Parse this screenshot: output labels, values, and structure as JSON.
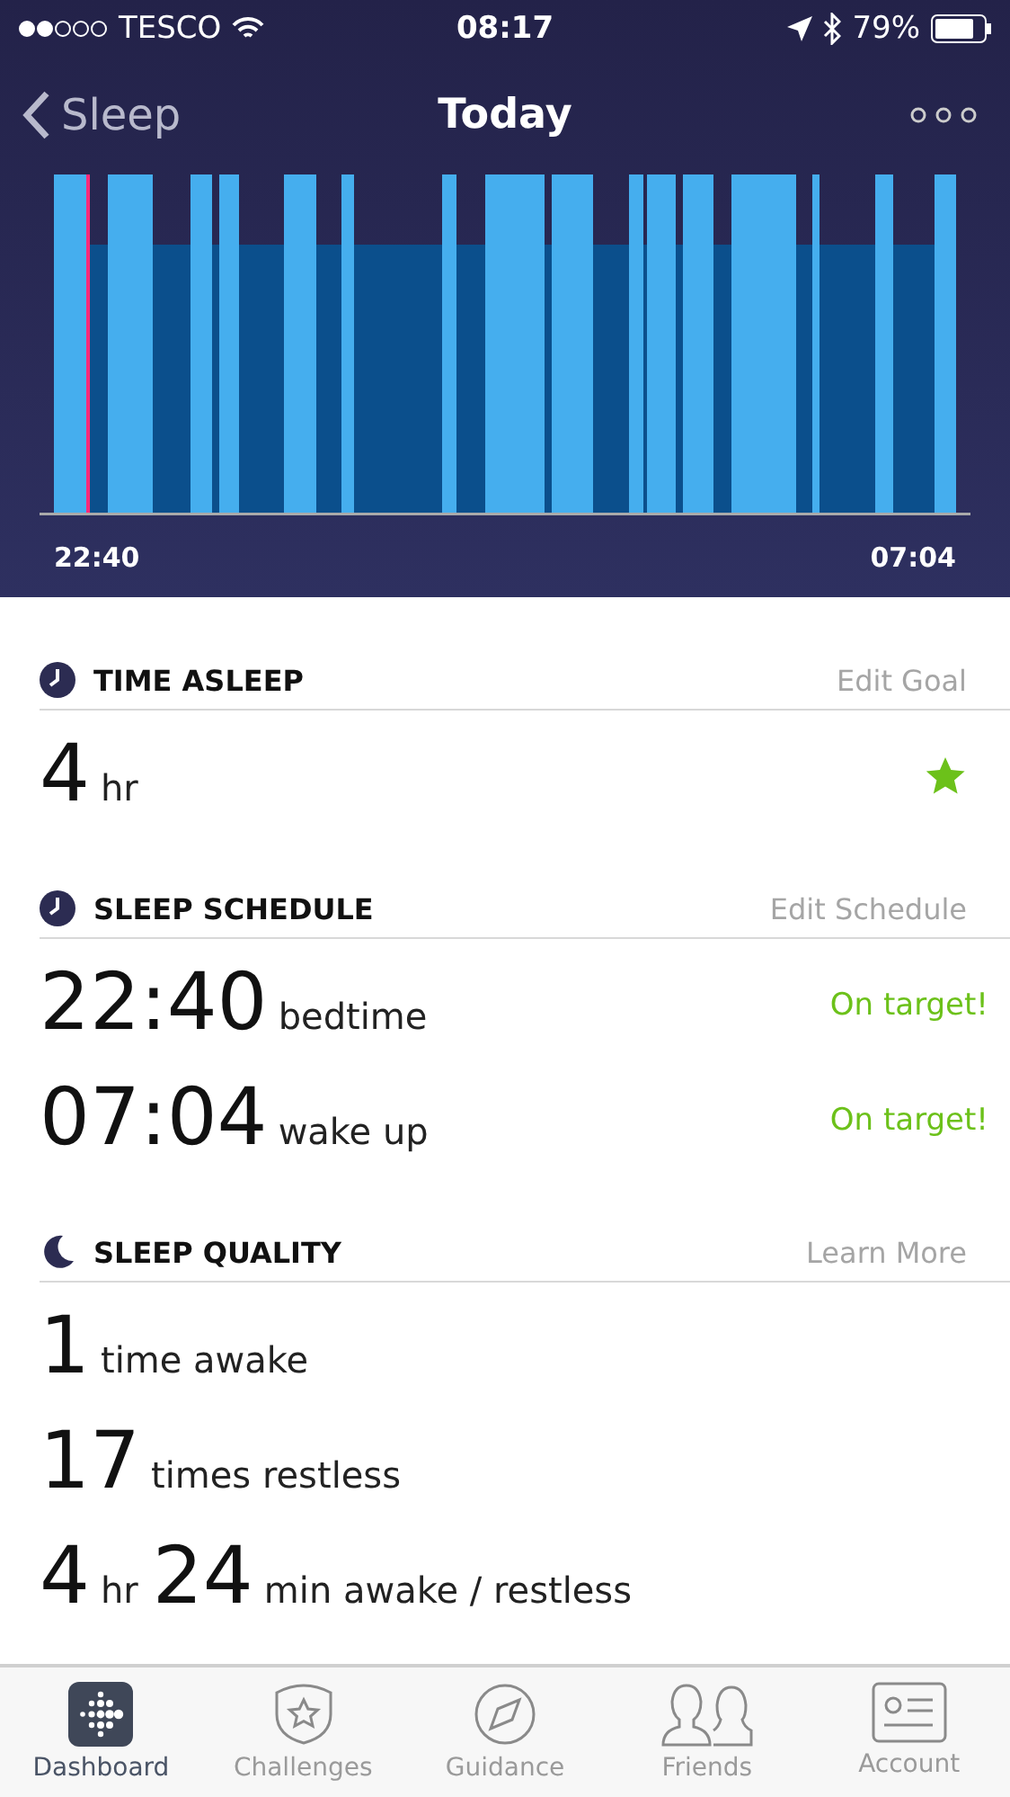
{
  "status_bar": {
    "carrier": "TESCO",
    "time": "08:17",
    "battery": "79%"
  },
  "nav": {
    "back": "Sleep",
    "title": "Today"
  },
  "sleep_chart": {
    "start": "22:40",
    "end": "07:04"
  },
  "sections": [
    {
      "kind": "clock",
      "title": "TIME ASLEEP",
      "action": "Edit Goal",
      "rows": [
        {
          "parts": [
            {
              "kind": "number",
              "text": "4"
            },
            {
              "kind": "unit",
              "text": "hr"
            }
          ],
          "goal_met": true
        }
      ]
    },
    {
      "kind": "clock",
      "title": "SLEEP SCHEDULE",
      "action": "Edit Schedule",
      "rows": [
        {
          "parts": [
            {
              "kind": "number",
              "text": "22:40"
            },
            {
              "kind": "unit",
              "text": "bedtime"
            }
          ],
          "status": "On target!"
        },
        {
          "parts": [
            {
              "kind": "number",
              "text": "07:04"
            },
            {
              "kind": "unit",
              "text": "wake up"
            }
          ],
          "status": "On target!"
        }
      ]
    },
    {
      "kind": "moon",
      "title": "SLEEP QUALITY",
      "action": "Learn More",
      "rows": [
        {
          "parts": [
            {
              "kind": "number",
              "text": "1"
            },
            {
              "kind": "unit",
              "text": "time awake"
            }
          ]
        },
        {
          "parts": [
            {
              "kind": "number",
              "text": "17"
            },
            {
              "kind": "unit",
              "text": "times restless"
            }
          ]
        },
        {
          "parts": [
            {
              "kind": "number",
              "text": "4"
            },
            {
              "kind": "unit",
              "text": "hr"
            },
            {
              "kind": "number",
              "text": "24"
            },
            {
              "kind": "unit",
              "text": "min awake / restless"
            }
          ]
        }
      ]
    }
  ],
  "tabs": [
    {
      "kind": "dashboard",
      "label": "Dashboard",
      "selected": true
    },
    {
      "kind": "badge",
      "label": "Challenges",
      "selected": false
    },
    {
      "kind": "compass",
      "label": "Guidance",
      "selected": false
    },
    {
      "kind": "people",
      "label": "Friends",
      "selected": false
    },
    {
      "kind": "card",
      "label": "Account",
      "selected": false
    }
  ]
}
